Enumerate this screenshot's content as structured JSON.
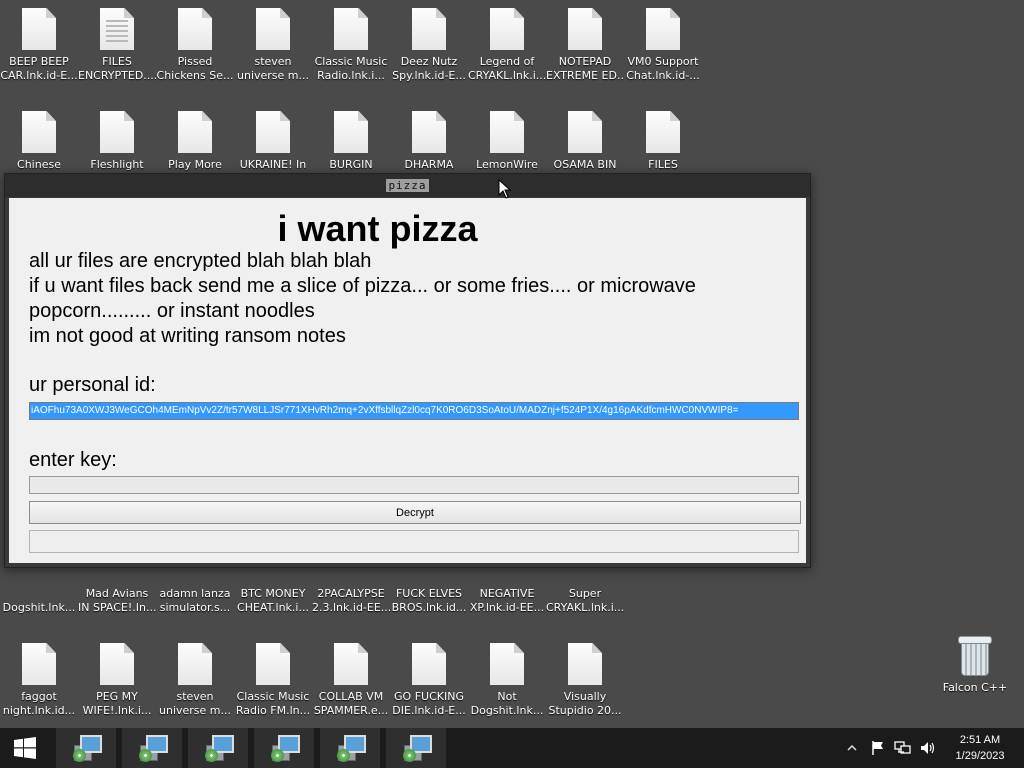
{
  "desktop": {
    "icons": [
      {
        "label": "BEEP BEEP\nCAR.lnk.id-E...",
        "type": "file"
      },
      {
        "label": "FILES\nENCRYPTED....",
        "type": "doc"
      },
      {
        "label": "Pissed\nChickens Se...",
        "type": "file"
      },
      {
        "label": "steven\nuniverse m...",
        "type": "file"
      },
      {
        "label": "Classic Music\nRadio.lnk.i...",
        "type": "file"
      },
      {
        "label": "Deez Nutz\nSpy.lnk.id-E...",
        "type": "file"
      },
      {
        "label": "Legend of\nCRYAKL.lnk.i...",
        "type": "file"
      },
      {
        "label": "NOTEPAD\nEXTREME ED...",
        "type": "file"
      },
      {
        "label": "VM0 Support\nChat.lnk.id-...",
        "type": "file"
      },
      {
        "label": "Chinese",
        "type": "file"
      },
      {
        "label": "Fleshlight",
        "type": "file"
      },
      {
        "label": "Play More",
        "type": "file"
      },
      {
        "label": "UKRAINE! In",
        "type": "file"
      },
      {
        "label": "BURGIN",
        "type": "file"
      },
      {
        "label": "DHARMA",
        "type": "file"
      },
      {
        "label": "LemonWire",
        "type": "file"
      },
      {
        "label": "OSAMA BIN",
        "type": "file"
      },
      {
        "label": "FILES",
        "type": "file"
      },
      {
        "label": "Dogshit.lnk...",
        "type": "none"
      },
      {
        "label": "Mad Avians\nIN SPACE!.In...",
        "type": "none"
      },
      {
        "label": "adamn lanza\nsimulator.s...",
        "type": "none"
      },
      {
        "label": "BTC MONEY\nCHEAT.lnk.i...",
        "type": "none"
      },
      {
        "label": "2PACALYPSE\n2.3.lnk.id-EE...",
        "type": "none"
      },
      {
        "label": "FUCK ELVES\nBROS.lnk.id...",
        "type": "none"
      },
      {
        "label": "NEGATIVE\nXP.lnk.id-EE...",
        "type": "none"
      },
      {
        "label": "Super\nCRYAKL.lnk.i...",
        "type": "none"
      },
      {
        "label": "faggot\nnight.lnk.id...",
        "type": "file"
      },
      {
        "label": "PEG MY\nWIFE!.lnk.i...",
        "type": "file"
      },
      {
        "label": "steven\nuniverse m...",
        "type": "file"
      },
      {
        "label": "Classic Music\nRadio FM.ln...",
        "type": "file"
      },
      {
        "label": "COLLAB VM\nSPAMMER.e...",
        "type": "file"
      },
      {
        "label": "GO FUCKING\nDIE.lnk.id-E...",
        "type": "file"
      },
      {
        "label": "Not\nDogshit.lnk...",
        "type": "file"
      },
      {
        "label": "Visually\nStupidio 20...",
        "type": "file"
      }
    ],
    "recycle_bin": {
      "label": "Falcon C++",
      "icon": "recycle-bin-icon"
    }
  },
  "window": {
    "title": "pizza",
    "heading": "i want pizza",
    "lines": [
      "all ur files are encrypted blah blah blah",
      "if u want files back send me a slice of pizza... or some fries.... or microwave popcorn......... or instant noodles",
      "im not good at writing ransom notes"
    ],
    "personal_id_label": "ur personal id:",
    "personal_id": "iAOFhu73A0XWJ3WeGCOh4MEmNpVv2Z/tr57W8LLJSr771XHvRh2mq+2vXffsbllqZzl0cq7K0RO6D3SoAtoU/MADZnj+f524P1X/4g16pAKdfcmHWC0NVWIP8=",
    "enter_key_label": "enter key:",
    "key_value": "",
    "decrypt_label": "Decrypt",
    "status_value": ""
  },
  "taskbar": {
    "start_icon": "windows-logo-icon",
    "items": [
      "setup-icon",
      "setup-icon",
      "setup-icon",
      "setup-icon",
      "setup-icon",
      "setup-icon"
    ],
    "time": "2:51 AM",
    "date": "1/29/2023",
    "tray_icons": [
      "chevron-up-icon",
      "flag-icon",
      "network-icon",
      "speaker-icon"
    ]
  }
}
